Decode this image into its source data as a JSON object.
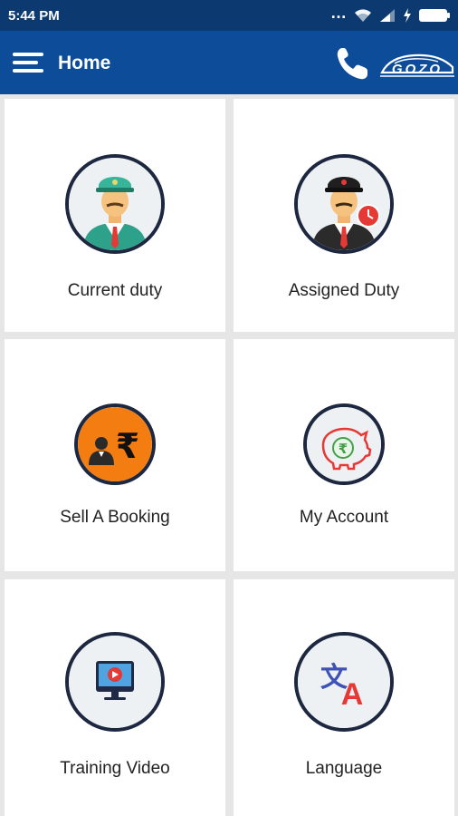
{
  "status_bar": {
    "time": "5:44 PM",
    "icons": [
      "more-dots-icon",
      "wifi-icon",
      "cell-signal-icon",
      "charging-icon",
      "battery-icon"
    ]
  },
  "app_bar": {
    "title": "Home",
    "logo_text": "GOZO",
    "icons": [
      "hamburger-menu-icon",
      "phone-icon",
      "gozo-car-logo"
    ]
  },
  "tiles": [
    {
      "label": "Current duty",
      "icon": "driver-icon"
    },
    {
      "label": "Assigned Duty",
      "icon": "driver-clock-icon"
    },
    {
      "label": "Sell A Booking",
      "icon": "rupee-agent-icon"
    },
    {
      "label": "My Account",
      "icon": "rupee-piggy-bank-icon"
    },
    {
      "label": "Training Video",
      "icon": "monitor-video-icon"
    },
    {
      "label": "Language",
      "icon": "translate-icon"
    }
  ],
  "colors": {
    "status_bar": "#0c3a70",
    "app_bar": "#0d4c98",
    "background": "#e6e6e6",
    "tile": "#ffffff",
    "circle_border": "#1d2840",
    "orange": "#f47d12",
    "red": "#e53935"
  }
}
